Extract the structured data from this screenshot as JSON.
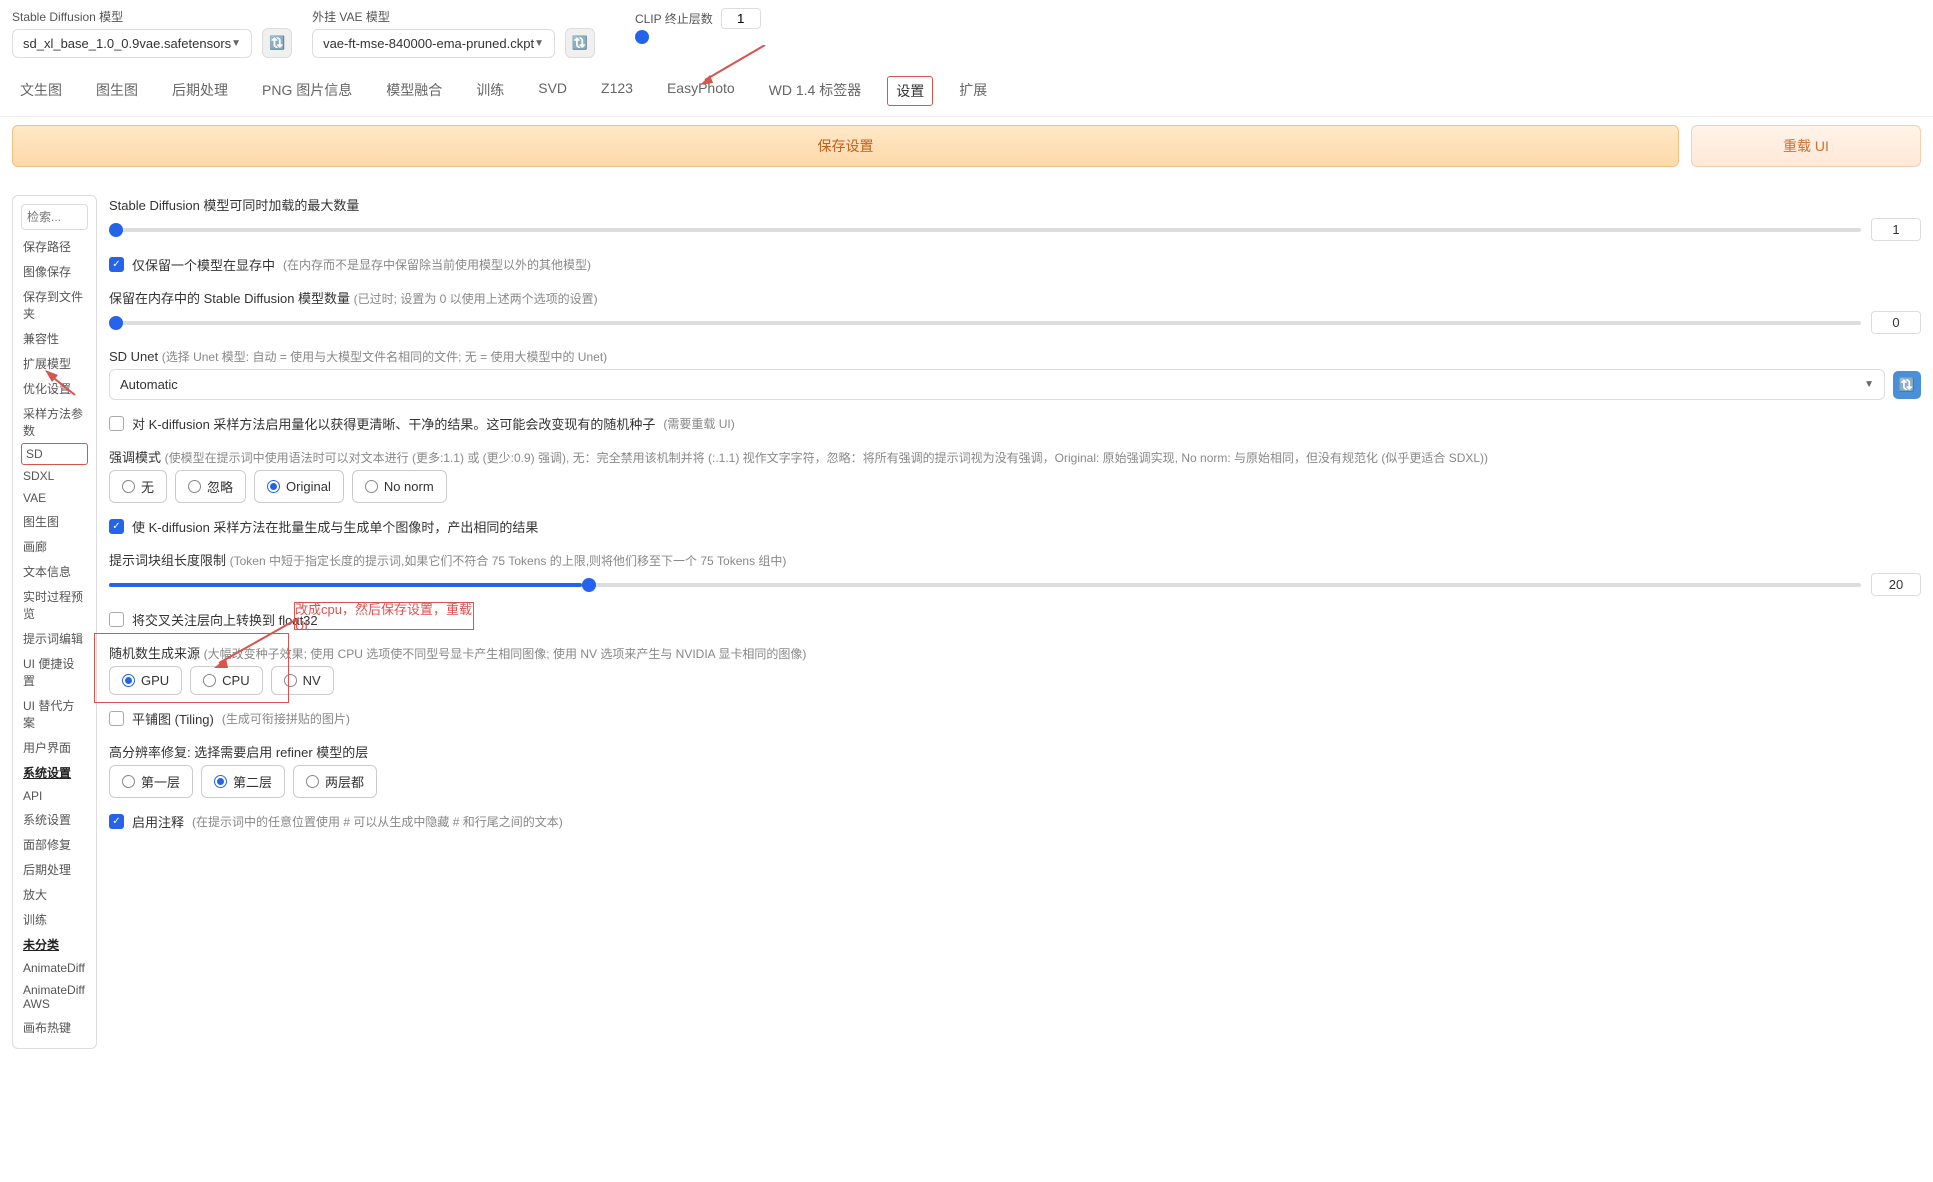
{
  "header": {
    "sd_model_label": "Stable Diffusion 模型",
    "sd_model_value": "sd_xl_base_1.0_0.9vae.safetensors",
    "vae_label": "外挂 VAE 模型",
    "vae_value": "vae-ft-mse-840000-ema-pruned.ckpt",
    "clip_label": "CLIP 终止层数",
    "clip_value": "1"
  },
  "tabs": [
    "文生图",
    "图生图",
    "后期处理",
    "PNG 图片信息",
    "模型融合",
    "训练",
    "SVD",
    "Z123",
    "EasyPhoto",
    "WD 1.4 标签器",
    "设置",
    "扩展"
  ],
  "tabs_active_index": 10,
  "buttons": {
    "save": "保存设置",
    "reload": "重载 UI"
  },
  "sidebar": {
    "search_placeholder": "检索...",
    "items": [
      "保存路径",
      "图像保存",
      "保存到文件夹",
      "兼容性",
      "扩展模型",
      "优化设置",
      "采样方法参数",
      "SD",
      "SDXL",
      "VAE",
      "图生图",
      "画廊",
      "文本信息",
      "实时过程预览",
      "提示词编辑",
      "UI 便捷设置",
      "UI 替代方案",
      "用户界面",
      "系统设置",
      "API",
      "系统设置",
      "面部修复",
      "后期处理",
      "放大",
      "训练",
      "未分类",
      "AnimateDiff",
      "AnimateDiff AWS",
      "画布热键"
    ],
    "active_index": 7,
    "bold_indices": [
      18,
      25
    ]
  },
  "settings": {
    "max_models_label": "Stable Diffusion 模型可同时加载的最大数量",
    "max_models_value": "1",
    "keep_one_label": "仅保留一个模型在显存中",
    "keep_one_hint": "(在内存而不是显存中保留除当前使用模型以外的其他模型)",
    "mem_count_label": "保留在内存中的 Stable Diffusion 模型数量",
    "mem_count_hint": "(已过时; 设置为 0 以使用上述两个选项的设置)",
    "mem_count_value": "0",
    "unet_label": "SD Unet",
    "unet_hint": "(选择 Unet 模型: 自动 = 使用与大模型文件名相同的文件; 无 = 使用大模型中的 Unet)",
    "unet_value": "Automatic",
    "kdiff_quant_label": "对 K-diffusion 采样方法启用量化以获得更清晰、干净的结果。这可能会改变现有的随机种子",
    "kdiff_quant_hint": "(需要重载 UI)",
    "emphasis_label": "强调模式",
    "emphasis_hint": "(使模型在提示词中使用语法时可以对文本进行 (更多:1.1) 或 (更少:0.9) 强调), 无：完全禁用该机制并将 (:.1.1) 视作文字字符，忽略：将所有强调的提示词视为没有强调，Original: 原始强调实现, No norm: 与原始相同，但没有规范化 (似乎更适合 SDXL))",
    "emphasis_options": [
      "无",
      "忽略",
      "Original",
      "No norm"
    ],
    "emphasis_selected": 2,
    "batch_same_label": "使 K-diffusion 采样方法在批量生成与生成单个图像时，产出相同的结果",
    "token_limit_label": "提示词块组长度限制",
    "token_limit_hint": "(Token 中短于指定长度的提示词,如果它们不符合 75 Tokens 的上限,则将他们移至下一个 75 Tokens 组中)",
    "token_limit_value": "20",
    "float32_label": "将交叉关注层向上转换到 float32",
    "rng_label": "随机数生成来源",
    "rng_hint": "(大幅改变种子效果; 使用 CPU 选项使不同型号显卡产生相同图像; 使用 NV 选项来产生与 NVIDIA 显卡相同的图像)",
    "rng_options": [
      "GPU",
      "CPU",
      "NV"
    ],
    "rng_selected": 0,
    "tiling_label": "平铺图 (Tiling)",
    "tiling_hint": "(生成可衔接拼贴的图片)",
    "refiner_label": "高分辨率修复: 选择需要启用 refiner 模型的层",
    "refiner_options": [
      "第一层",
      "第二层",
      "两层都"
    ],
    "refiner_selected": 1,
    "comments_label": "启用注释",
    "comments_hint": "(在提示词中的任意位置使用 # 可以从生成中隐藏 # 和行尾之间的文本)",
    "annotation_text": "改成cpu，然后保存设置，重载UI"
  }
}
